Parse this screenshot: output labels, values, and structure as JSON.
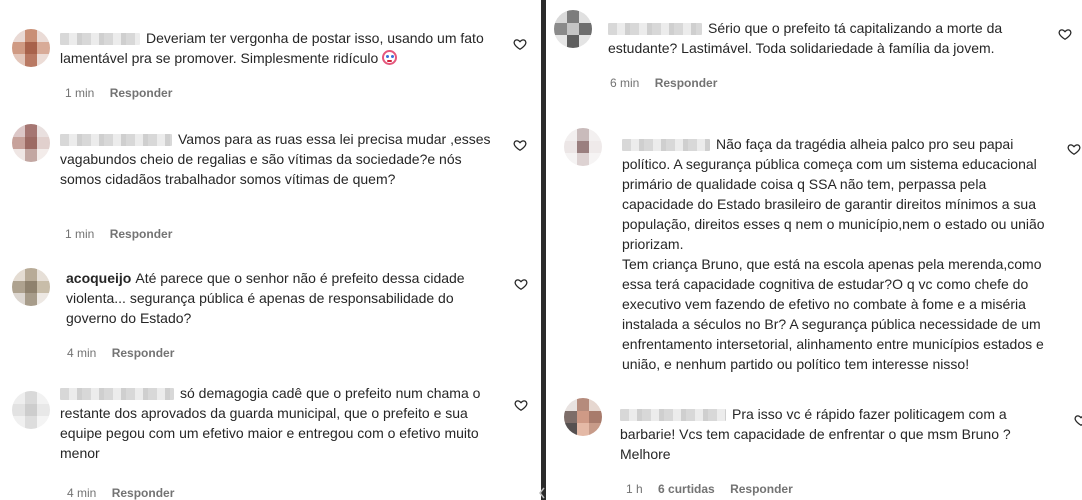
{
  "left_comments": [
    {
      "username": "",
      "text": "Deveriam ter vergonha de postar isso, usando um fato lamentável pra se promover. Simplesmente ridículo",
      "has_emoji": true,
      "emoji": "clown-face-icon",
      "time": "1 min",
      "reply_label": "Responder"
    },
    {
      "username": "",
      "text": "Vamos para as ruas essa lei precisa mudar ,esses vagabundos cheio de regalias e são vítimas da sociedade?e nós somos cidadãos trabalhador somos vítimas de quem?",
      "time": "1 min",
      "reply_label": "Responder"
    },
    {
      "username": "acoqueijo",
      "text": "Até parece que o senhor não é prefeito dessa cidade violenta... segurança pública é apenas de responsabilidade do governo do Estado?",
      "time": "4 min",
      "reply_label": "Responder"
    },
    {
      "username": "",
      "text": "só demagogia cadê que o prefeito num chama o restante dos aprovados da guarda municipal, que o prefeito e sua equipe pegou com um efetivo maior e entregou com o efetivo muito menor",
      "time": "4 min",
      "reply_label": "Responder"
    }
  ],
  "right_comments": [
    {
      "username": "",
      "text": "Sério que o prefeito tá capitalizando a morte da estudante? Lastimável. Toda solidariedade à família da jovem.",
      "time": "6 min",
      "reply_label": "Responder"
    },
    {
      "username": "",
      "text_lines": [
        "Não faça da tragédia alheia palco pro seu papai político. A segurança pública começa com um sistema educacional primário de qualidade coisa q SSA não tem, perpassa pela capacidade do Estado brasileiro de garantir direitos mínimos a sua população, direitos esses q nem o município,nem o estado ou união priorizam.",
        "Tem criança Bruno, que está na escola apenas pela merenda,como essa terá capacidade cognitiva de estudar?O q vc como chefe do executivo vem fazendo de efetivo no combate à fome e a miséria instalada a séculos no Br? A segurança pública necessidade de um enfrentamento intersetorial, alinhamento entre municípios estados e união, e nenhum partido ou político tem interesse nisso!"
      ]
    },
    {
      "username": "",
      "text": "Pra isso vc é rápido fazer politicagem com a barbarie! Vcs tem capacidade de enfrentar o que msm Bruno ? Melhore",
      "time": "1 h",
      "likes": "6 curtidas",
      "reply_label": "Responder"
    }
  ],
  "colors": {
    "text": "#262626",
    "meta": "#737373",
    "divider": "#2b2b2b",
    "background": "#ffffff"
  }
}
